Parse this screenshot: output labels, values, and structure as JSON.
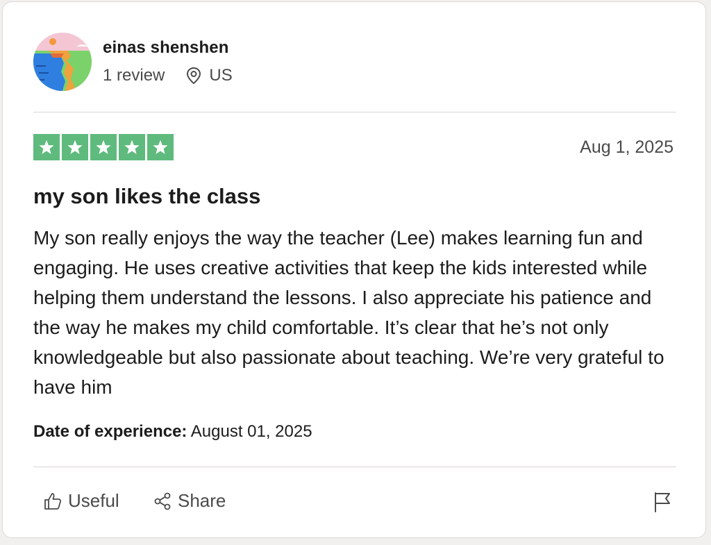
{
  "reviewer": {
    "name": "einas shenshen",
    "review_count": "1 review",
    "location": "US"
  },
  "review": {
    "rating": 5,
    "max_rating": 5,
    "date": "Aug 1, 2025",
    "title": "my son likes the class",
    "body": "My son really enjoys the way the teacher (Lee) makes learning fun and engaging. He uses creative activities that keep the kids interested while helping them understand the lessons. I also appreciate his patience and the way he makes my child comfortable. It’s clear that he’s not only knowledgeable but also passionate about teaching. We’re very grateful to have him",
    "experience_label": "Date of experience:",
    "experience_date": "August 01, 2025"
  },
  "actions": {
    "useful_label": "Useful",
    "share_label": "Share"
  },
  "icons": {
    "location": "map-pin-icon",
    "useful": "thumbs-up-icon",
    "share": "share-icon",
    "flag": "flag-icon",
    "star": "star-icon"
  },
  "colors": {
    "star_fill": "#5fba7d",
    "text_primary": "#1c1c1c",
    "text_secondary": "#4a4a4a"
  }
}
